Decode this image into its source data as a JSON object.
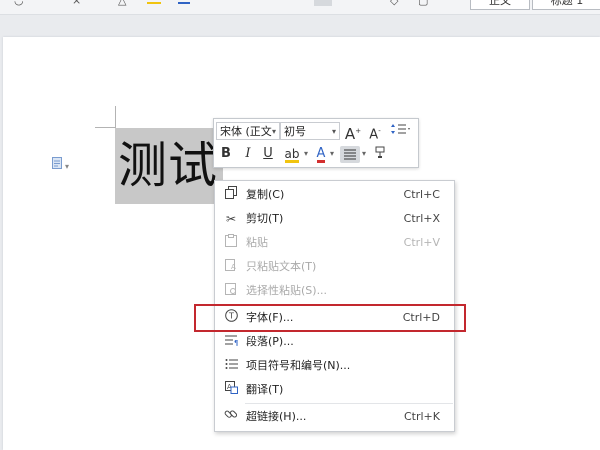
{
  "ribbon": {
    "style_normal": "正文",
    "style_heading1": "标题 1"
  },
  "document": {
    "selected_text": "测试"
  },
  "mini_toolbar": {
    "font_name": "宋体 (正文",
    "font_size": "初号",
    "grow_font": "A",
    "shrink_font": "A",
    "bold": "B",
    "italic": "I",
    "underline": "U",
    "highlight": "ab",
    "font_color": "A"
  },
  "context_menu": {
    "items": [
      {
        "label": "复制(C)",
        "shortcut": "Ctrl+C",
        "icon": "copy-icon",
        "enabled": true
      },
      {
        "label": "剪切(T)",
        "shortcut": "Ctrl+X",
        "icon": "scissors-icon",
        "enabled": true
      },
      {
        "label": "粘贴",
        "shortcut": "Ctrl+V",
        "icon": "paste-icon",
        "enabled": false
      },
      {
        "label": "只粘贴文本(T)",
        "shortcut": "",
        "icon": "paste-text-icon",
        "enabled": false
      },
      {
        "label": "选择性粘贴(S)...",
        "shortcut": "",
        "icon": "paste-special-icon",
        "enabled": false
      },
      {
        "label": "字体(F)...",
        "shortcut": "Ctrl+D",
        "icon": "font-icon",
        "enabled": true
      },
      {
        "label": "段落(P)...",
        "shortcut": "",
        "icon": "paragraph-icon",
        "enabled": true
      },
      {
        "label": "项目符号和编号(N)...",
        "shortcut": "",
        "icon": "bullets-icon",
        "enabled": true
      },
      {
        "label": "翻译(T)",
        "shortcut": "",
        "icon": "translate-icon",
        "enabled": true
      },
      {
        "label": "超链接(H)...",
        "shortcut": "Ctrl+K",
        "icon": "link-icon",
        "enabled": true
      }
    ]
  },
  "colors": {
    "highlight_box": "#c3282e",
    "selection": "#c8c8c8",
    "font_color_underline": "#d32f2f",
    "highlight_underline": "#f1c40f"
  }
}
